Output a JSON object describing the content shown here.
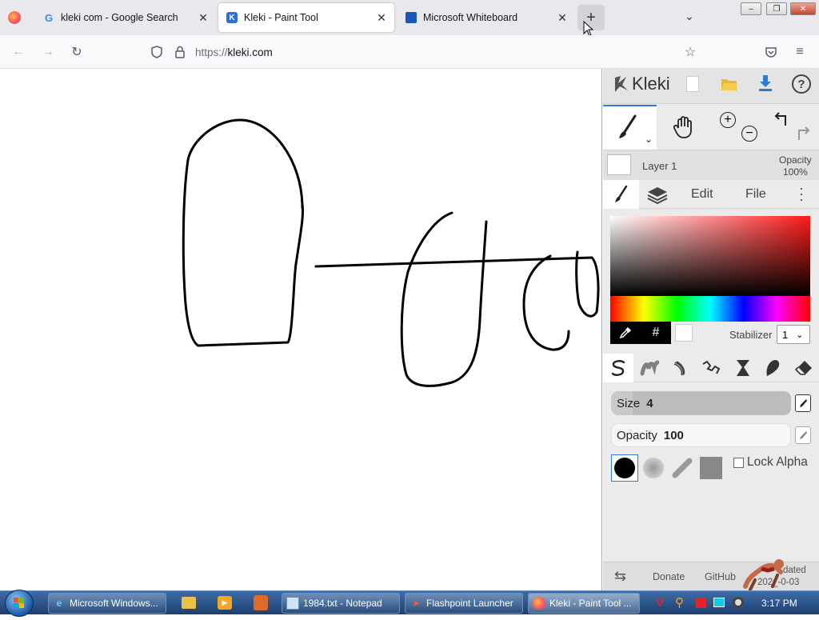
{
  "browser": {
    "tabs": [
      {
        "title": "kleki com - Google Search",
        "icon": "google-icon"
      },
      {
        "title": "Kleki - Paint Tool",
        "icon": "kleki-icon",
        "active": true
      },
      {
        "title": "Microsoft Whiteboard",
        "icon": "whiteboard-icon"
      }
    ],
    "new_tab_label": "+",
    "url": "https://kleki.com",
    "url_prefix": "https://",
    "url_host": "kleki.com"
  },
  "kleki": {
    "logo_text": "Kleki",
    "layer": {
      "name": "Layer 1",
      "opacity_label": "Opacity",
      "opacity_value": "100%"
    },
    "tabs": {
      "edit": "Edit",
      "file": "File"
    },
    "hex_label": "#",
    "stabilizer_label": "Stabilizer",
    "stabilizer_value": "1",
    "size_label": "Size",
    "size_value": "4",
    "size_fraction": 0.12,
    "opacity_label": "Opacity",
    "opacity_value": "100",
    "lock_alpha_label": "Lock Alpha",
    "footer": {
      "donate": "Donate",
      "github": "GitHub",
      "updated_partial": "dated",
      "date_partial": "202_-0-03"
    },
    "colors": {
      "primary": "#000000",
      "secondary": "#ffffff",
      "accent": "#2e7bd1"
    }
  },
  "taskbar": {
    "items": [
      {
        "label": "Microsoft Windows...",
        "icon": "ie-icon"
      },
      {
        "label": "1984.txt - Notepad",
        "icon": "notepad-icon"
      },
      {
        "label": "Flashpoint Launcher",
        "icon": "flashpoint-icon"
      },
      {
        "label": "Kleki - Paint Tool ...",
        "icon": "firefox-icon"
      }
    ],
    "clock": "3:17 PM"
  }
}
